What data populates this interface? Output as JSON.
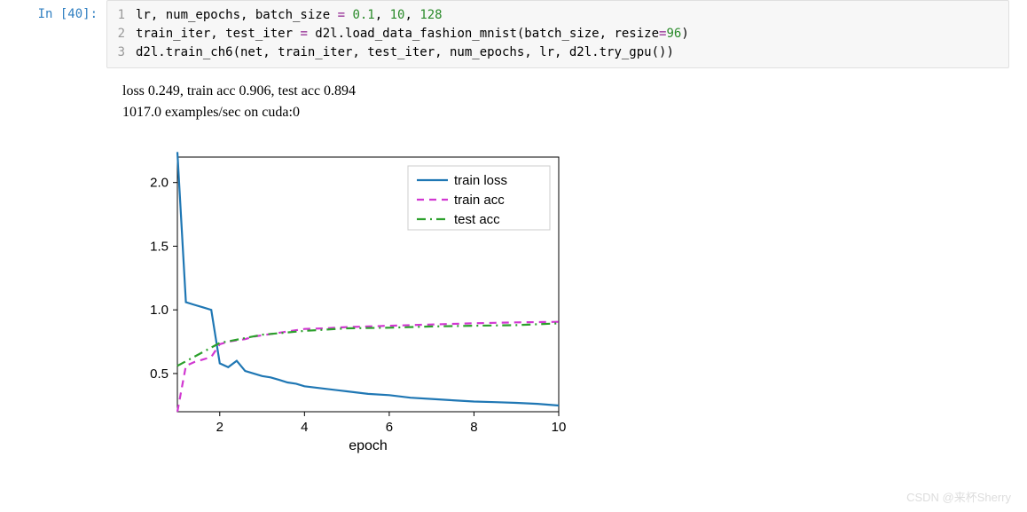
{
  "cell": {
    "prompt": "In [40]:",
    "lines": [
      {
        "n": "1",
        "tokens": [
          "lr, num_epochs, batch_size ",
          "=",
          " ",
          "0.1",
          ", ",
          "10",
          ", ",
          "128"
        ],
        "types": [
          "",
          "op",
          "",
          "num",
          "",
          "num",
          "",
          "num"
        ]
      },
      {
        "n": "2",
        "tokens": [
          "train_iter, test_iter ",
          "=",
          " d2l.load_data_fashion_mnist(batch_size, resize",
          "=",
          "96",
          ")"
        ],
        "types": [
          "",
          "op",
          "",
          "op",
          "num",
          ""
        ]
      },
      {
        "n": "3",
        "tokens": [
          "d2l.train_ch6(net, train_iter, test_iter, num_epochs, lr, d2l.try_gpu())"
        ],
        "types": [
          ""
        ]
      }
    ]
  },
  "output": {
    "line1": "loss 0.249, train acc 0.906, test acc 0.894",
    "line2": "1017.0 examples/sec on cuda:0"
  },
  "watermark": "CSDN @来杯Sherry",
  "chart_data": {
    "type": "line",
    "xlabel": "epoch",
    "ylabel": "",
    "xlim": [
      1,
      10
    ],
    "ylim": [
      0.2,
      2.2
    ],
    "xticks": [
      2,
      4,
      6,
      8,
      10
    ],
    "yticks": [
      0.5,
      1.0,
      1.5,
      2.0
    ],
    "legend_pos": "upper-right",
    "series": [
      {
        "name": "train loss",
        "color": "#1f77b4",
        "dash": "solid",
        "x": [
          1.0,
          1.2,
          1.4,
          1.6,
          1.8,
          2.0,
          2.2,
          2.4,
          2.6,
          2.8,
          3.0,
          3.2,
          3.4,
          3.6,
          3.8,
          4.0,
          4.5,
          5.0,
          5.5,
          6.0,
          6.5,
          7.0,
          7.5,
          8.0,
          8.5,
          9.0,
          9.5,
          10.0
        ],
        "y": [
          2.24,
          1.06,
          1.04,
          1.02,
          1.0,
          0.58,
          0.55,
          0.6,
          0.52,
          0.5,
          0.48,
          0.47,
          0.45,
          0.43,
          0.42,
          0.4,
          0.38,
          0.36,
          0.34,
          0.33,
          0.31,
          0.3,
          0.29,
          0.28,
          0.275,
          0.27,
          0.262,
          0.249
        ]
      },
      {
        "name": "train acc",
        "color": "#d138d1",
        "dash": "dashed",
        "x": [
          1.0,
          1.2,
          1.4,
          1.6,
          1.8,
          2.0,
          2.2,
          2.4,
          2.6,
          2.8,
          3.0,
          3.5,
          4.0,
          4.5,
          5.0,
          5.5,
          6.0,
          6.5,
          7.0,
          7.5,
          8.0,
          8.5,
          9.0,
          9.5,
          10.0
        ],
        "y": [
          0.2,
          0.56,
          0.59,
          0.61,
          0.63,
          0.73,
          0.75,
          0.76,
          0.77,
          0.79,
          0.8,
          0.825,
          0.85,
          0.855,
          0.865,
          0.87,
          0.875,
          0.88,
          0.885,
          0.89,
          0.895,
          0.898,
          0.902,
          0.904,
          0.906
        ]
      },
      {
        "name": "test acc",
        "color": "#2ca02c",
        "dash": "dashdot",
        "x": [
          1,
          2,
          3,
          4,
          5,
          6,
          7,
          8,
          9,
          10
        ],
        "y": [
          0.56,
          0.74,
          0.805,
          0.835,
          0.855,
          0.86,
          0.87,
          0.875,
          0.88,
          0.894
        ]
      }
    ]
  }
}
